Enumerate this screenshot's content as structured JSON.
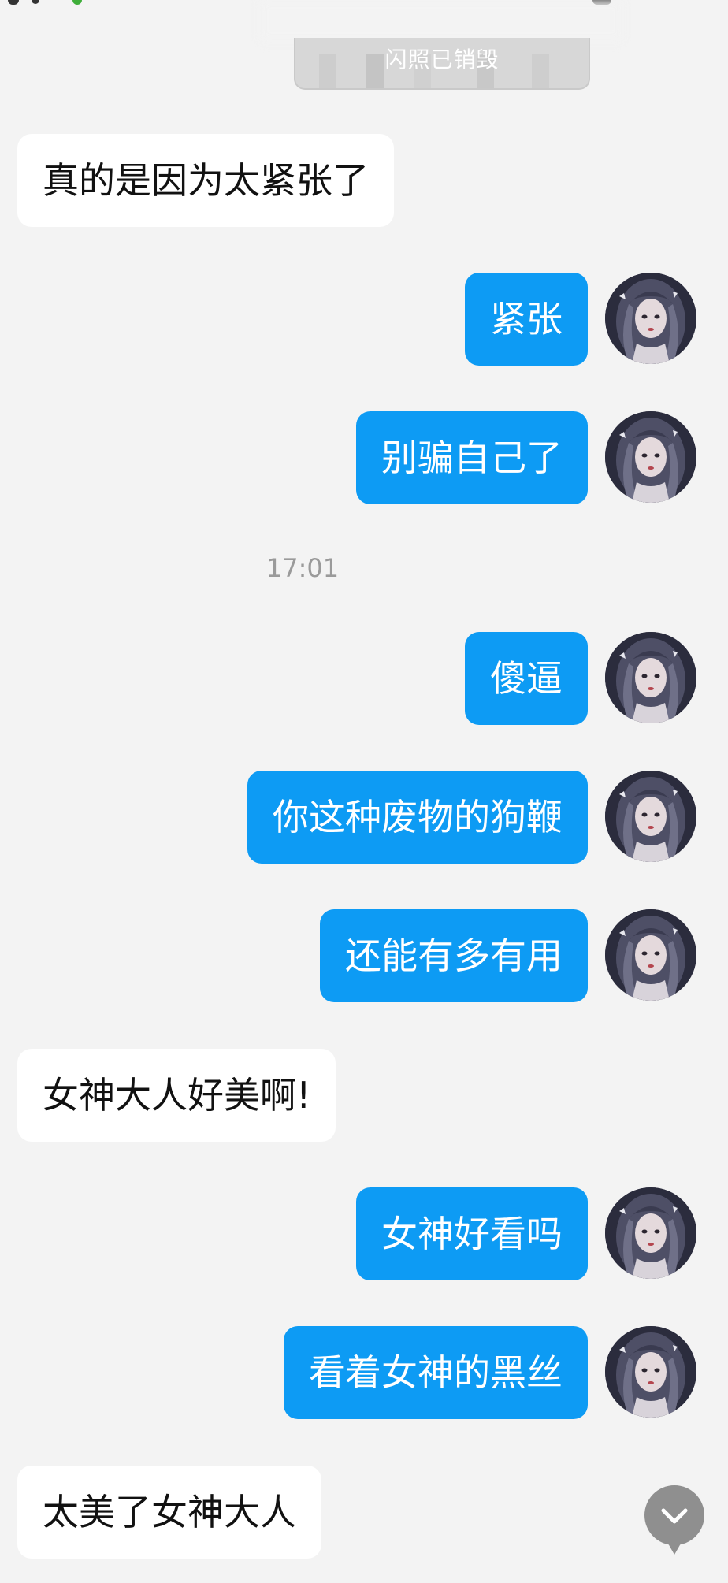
{
  "top_media": {
    "caption": "闪照已销毁"
  },
  "timestamp": "17:01",
  "messages": [
    {
      "dir": "in",
      "text": "真的是因为太紧张了"
    },
    {
      "dir": "out",
      "text": "紧张"
    },
    {
      "dir": "out",
      "text": "别骗自己了"
    },
    {
      "dir": "out",
      "text": "傻逼"
    },
    {
      "dir": "out",
      "text": "你这种废物的狗鞭"
    },
    {
      "dir": "out",
      "text": "还能有多有用"
    },
    {
      "dir": "in",
      "text": "女神大人好美啊!"
    },
    {
      "dir": "out",
      "text": "女神好看吗"
    },
    {
      "dir": "out",
      "text": "看着女神的黑丝"
    },
    {
      "dir": "in",
      "text": "太美了女神大人"
    }
  ],
  "colors": {
    "background": "#f3f3f3",
    "outgoing_bubble": "#0d9bf4",
    "incoming_bubble": "#ffffff",
    "timestamp": "#9a9a9a"
  },
  "icons": {
    "scroll_down": "chevron-down-icon",
    "avatar": "avatar"
  }
}
